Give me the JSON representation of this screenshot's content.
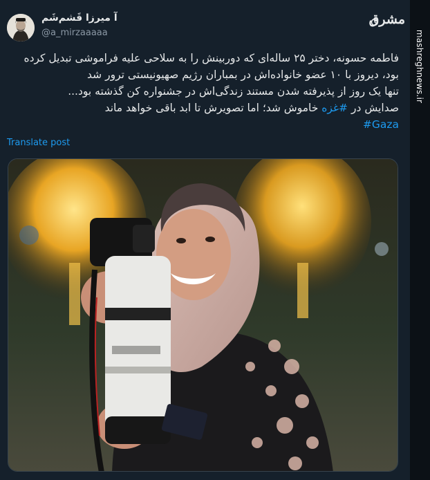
{
  "author": {
    "display_name": "آ میرزا قَشم‌شَم",
    "handle": "@a_mirzaaaaa"
  },
  "brand": {
    "logo_text": "مشرق",
    "side_watermark": "mashreghnews.ir"
  },
  "tweet": {
    "lines": [
      "فاطمه حسونه، دختر ۲۵ ساله‌ای که دوربینش را به سلاحی علیه فراموشی تبدیل کرده",
      "بود، دیروز با ۱۰ عضو خانواده‌اش در بمباران رژیم صهیونیستی ترور شد",
      "تنها یک روز از پذیرفته شدن مستند زندگی‌اش در جشنواره کن گذشته بود...",
      "خاموش شد؛ اما تصویرش تا ابد باقی خواهد ماند"
    ],
    "line4_prefix": "صدایش در",
    "hashtag_inline": "#غزه",
    "hashtag_last": "#Gaza",
    "translate_label": "Translate post"
  },
  "colors": {
    "background": "#15202b",
    "link": "#1d9bf0",
    "text": "#e7e9ea",
    "muted": "#8b98a5"
  }
}
